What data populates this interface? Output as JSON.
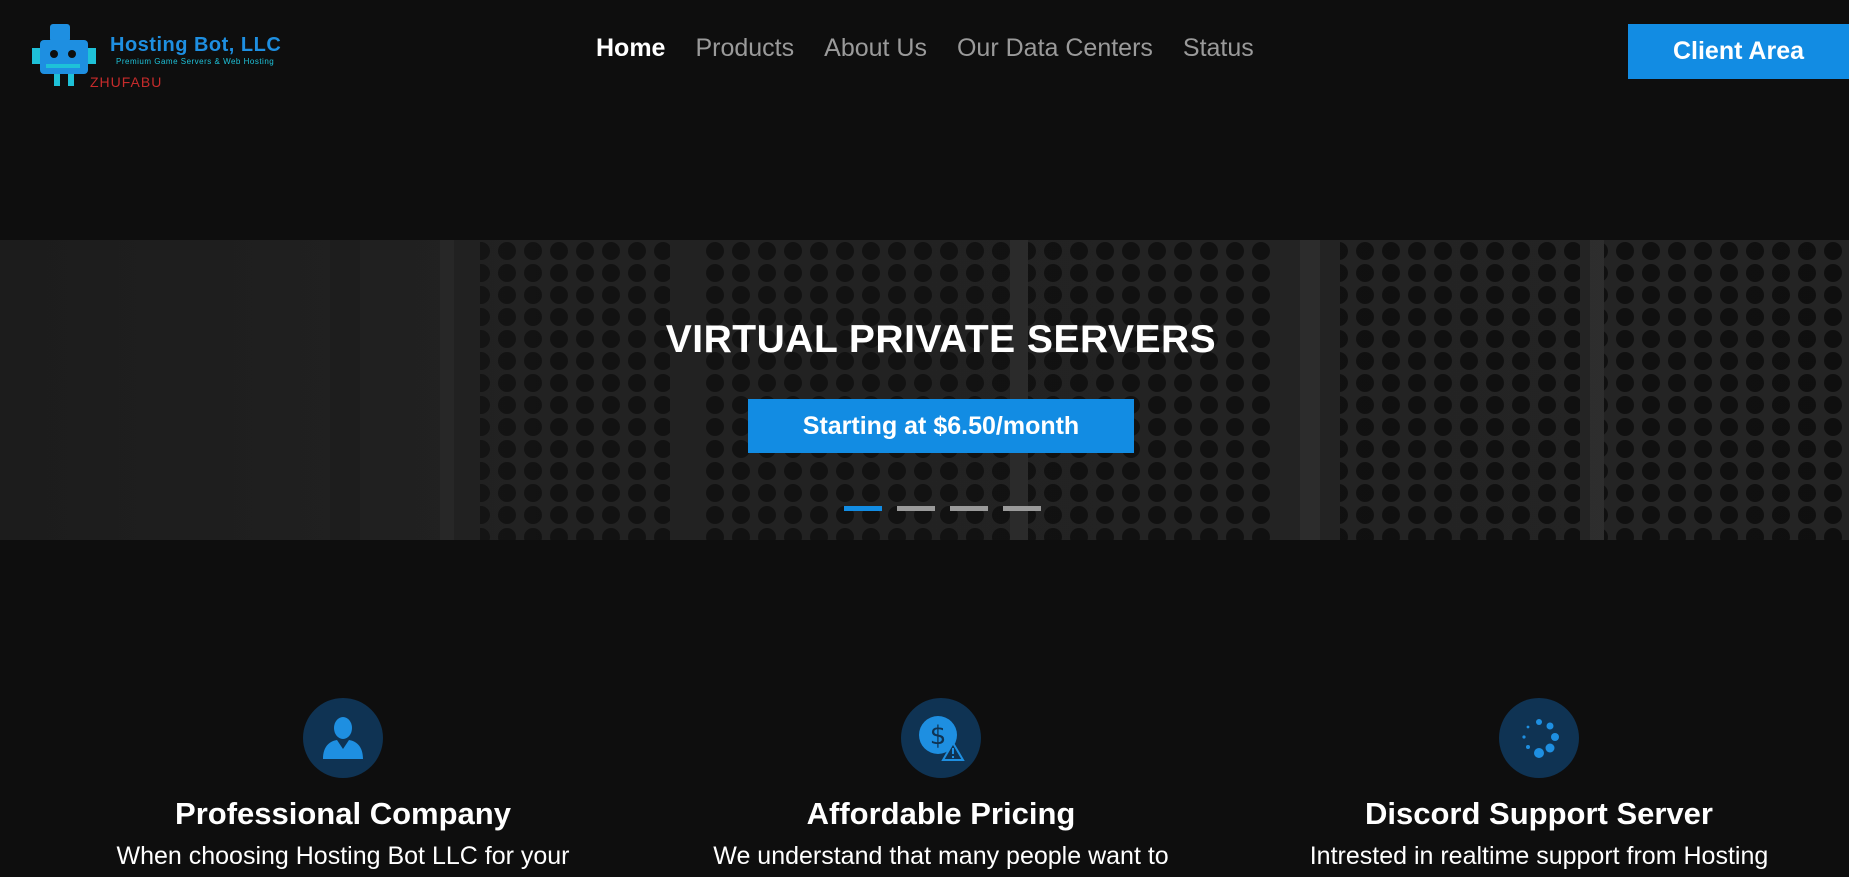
{
  "brand": {
    "name": "Hosting Bot, LLC",
    "tagline": "Premium Game Servers & Web Hosting",
    "watermark": "ZHUFABU",
    "accent": "#128ce3"
  },
  "nav": {
    "items": [
      {
        "label": "Home",
        "active": true
      },
      {
        "label": "Products",
        "active": false
      },
      {
        "label": "About Us",
        "active": false
      },
      {
        "label": "Our Data Centers",
        "active": false
      },
      {
        "label": "Status",
        "active": false
      }
    ],
    "client_area_label": "Client Area"
  },
  "hero": {
    "title": "VIRTUAL PRIVATE SERVERS",
    "cta_label": "Starting at $6.50/month",
    "slide_count": 4,
    "active_slide": 0
  },
  "features": [
    {
      "icon": "user-icon",
      "title": "Professional Company",
      "text": "When choosing Hosting Bot LLC for your"
    },
    {
      "icon": "dollar-warning-icon",
      "title": "Affordable Pricing",
      "text": "We understand that many people want to"
    },
    {
      "icon": "spinner-icon",
      "title": "Discord Support Server",
      "text": "Intrested in realtime support from Hosting"
    }
  ]
}
